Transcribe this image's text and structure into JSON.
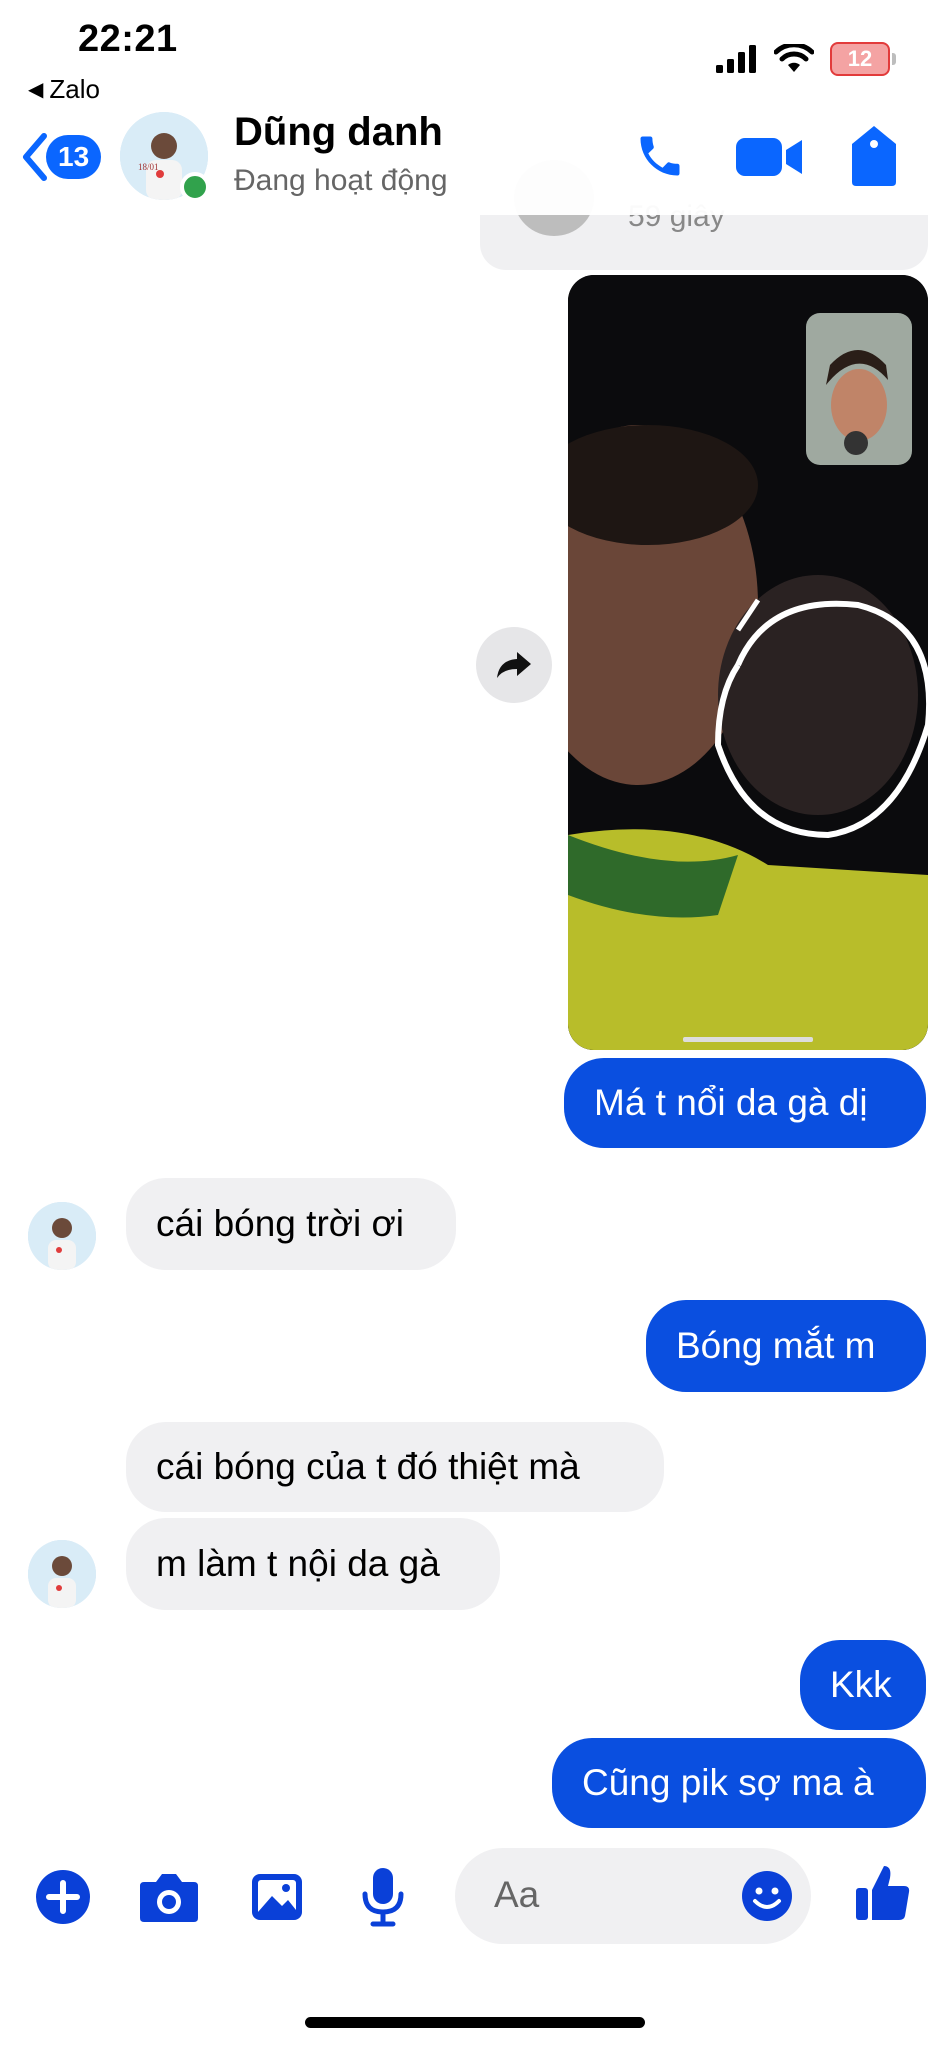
{
  "status_bar": {
    "time": "22:21",
    "back_app": "Zalo",
    "battery": "12"
  },
  "header": {
    "back_badge": "13",
    "contact_name": "Dũng danh",
    "status": "Đang hoạt động"
  },
  "messages": {
    "previous_call_duration": "59 giây",
    "m1": "Má t nổi da gà dị",
    "m2": "cái bóng trời ơi",
    "m3": "Bóng mắt m",
    "m4": "cái bóng của t đó thiệt mà",
    "m5": "m làm t nội da gà",
    "m6": "Kkk",
    "m7": "Cũng pik sợ ma à"
  },
  "composer": {
    "placeholder": "Aa"
  },
  "colors": {
    "accent": "#0a66ff",
    "outgoing_bubble": "#0a4fe0",
    "incoming_bubble": "#f0f0f2",
    "online": "#31a24c"
  }
}
